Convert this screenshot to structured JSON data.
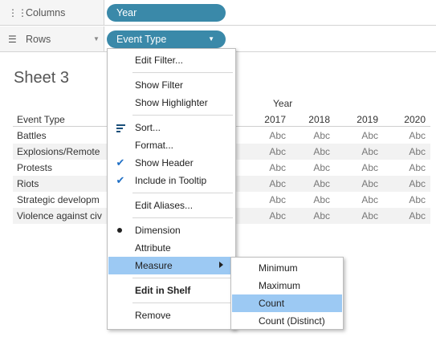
{
  "shelves": {
    "columns": {
      "label": "Columns",
      "icon": "columns-icon",
      "pill": "Year"
    },
    "rows": {
      "label": "Rows",
      "icon": "rows-icon",
      "pill": "Event Type"
    }
  },
  "sheet": {
    "title": "Sheet 3",
    "column_title": "Year",
    "row_header": "Event Type",
    "years": [
      "2017",
      "2018",
      "2019",
      "2020"
    ],
    "rows": [
      {
        "label": "Battles",
        "values": [
          "Abc",
          "Abc",
          "Abc",
          "Abc"
        ]
      },
      {
        "label": "Explosions/Remote",
        "values": [
          "Abc",
          "Abc",
          "Abc",
          "Abc"
        ]
      },
      {
        "label": "Protests",
        "values": [
          "Abc",
          "Abc",
          "Abc",
          "Abc"
        ]
      },
      {
        "label": "Riots",
        "values": [
          "Abc",
          "Abc",
          "Abc",
          "Abc"
        ]
      },
      {
        "label": "Strategic developm",
        "values": [
          "Abc",
          "Abc",
          "Abc",
          "Abc"
        ]
      },
      {
        "label": "Violence against civ",
        "values": [
          "Abc",
          "Abc",
          "Abc",
          "Abc"
        ]
      }
    ]
  },
  "context_menu": {
    "edit_filter": "Edit Filter...",
    "show_filter": "Show Filter",
    "show_highlighter": "Show Highlighter",
    "sort": "Sort...",
    "format": "Format...",
    "show_header": "Show Header",
    "include_in_tooltip": "Include in Tooltip",
    "edit_aliases": "Edit Aliases...",
    "dimension": "Dimension",
    "attribute": "Attribute",
    "measure": "Measure",
    "edit_in_shelf": "Edit in Shelf",
    "remove": "Remove",
    "checked": [
      "Show Header",
      "Include in Tooltip"
    ],
    "selected_role": "Dimension",
    "highlighted": "Measure"
  },
  "measure_submenu": {
    "items": [
      "Minimum",
      "Maximum",
      "Count",
      "Count (Distinct)"
    ],
    "highlighted": "Count"
  },
  "colors": {
    "pill": "#3a89a9",
    "highlight": "#9cc9f3",
    "check": "#1f6fc5"
  }
}
